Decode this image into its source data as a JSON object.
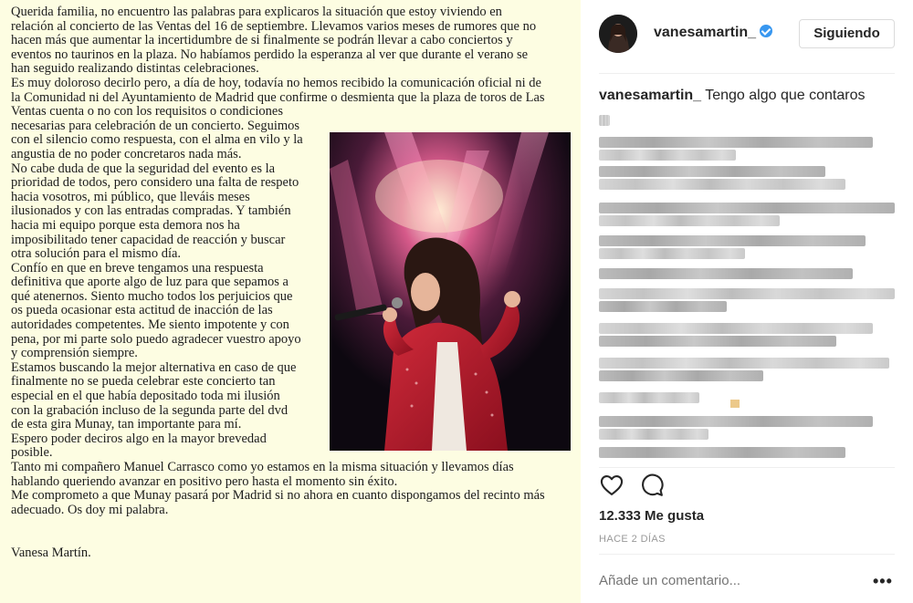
{
  "letter": {
    "lines_top": [
      "Querida familia, no encuentro las palabras para explicaros la situación que estoy viviendo en",
      "relación al concierto de las Ventas del 16 de septiembre. Llevamos varios meses de rumores que no",
      "hacen más que aumentar la incertidumbre de si finalmente se podrán llevar a cabo conciertos y",
      "eventos no taurinos en la plaza. No habíamos perdido la esperanza al ver que durante el verano se",
      "han seguido realizando distintas celebraciones.",
      "Es muy doloroso decirlo pero, a día de hoy, todavía no hemos recibido la comunicación oficial ni de",
      "la Comunidad ni del Ayuntamiento de Madrid que confirme o desmienta que la plaza de toros de Las",
      "Ventas cuenta o no con los requisitos o condiciones"
    ],
    "lines_narrow": [
      "necesarias para celebración de un concierto. Seguimos",
      "con el silencio como respuesta, con el alma en vilo y la",
      "angustia de no poder concretaros nada más.",
      "No cabe duda de que la seguridad del evento es la",
      "prioridad de todos, pero considero una falta de respeto",
      "hacia vosotros, mi público, que lleváis meses",
      "ilusionados y con las entradas compradas. Y también",
      "hacia mi equipo porque esta demora nos ha",
      "imposibilitado tener capacidad de reacción y buscar",
      "otra solución para el mismo día.",
      "Confío en que en breve tengamos una respuesta",
      "definitiva que aporte algo de luz para que sepamos a",
      "qué atenernos. Siento mucho todos los perjuicios que",
      "os pueda ocasionar esta actitud de inacción de las",
      "autoridades competentes. Me siento impotente y con",
      "pena, por mi parte solo puedo agradecer vuestro apoyo",
      "y comprensión siempre.",
      "Estamos buscando la mejor alternativa en caso de que",
      "finalmente no se pueda celebrar este concierto tan",
      "especial en el que había depositado toda mi ilusión",
      "con la grabación incluso de la segunda parte del dvd",
      "de esta gira Munay, tan importante para mí.",
      "Espero poder deciros algo en la mayor brevedad",
      "posible."
    ],
    "lines_bottom": [
      "Tanto mi compañero Manuel Carrasco como yo estamos en la misma situación y llevamos días",
      "hablando queriendo avanzar en positivo pero hasta el momento sin éxito.",
      "Me comprometo a que Munay pasará por Madrid si no ahora en cuanto dispongamos del recinto más",
      "adecuado. Os doy mi palabra."
    ],
    "signature": "Vanesa Martín."
  },
  "post": {
    "username": "vanesamartin_",
    "follow_label": "Siguiendo",
    "caption_user": "vanesamartin_",
    "caption_text": "Tengo algo que contaros",
    "likes": "12.333 Me gusta",
    "time": "HACE 2 DÍAS",
    "comment_placeholder": "Añade un comentario...",
    "more_label": "•••"
  },
  "colors": {
    "letter_bg": "#fdfde2",
    "verified_blue": "#3897f0",
    "muted_gray": "#999999"
  },
  "icons": [
    "verified-badge-icon",
    "heart-icon",
    "comment-icon",
    "more-options-icon"
  ]
}
